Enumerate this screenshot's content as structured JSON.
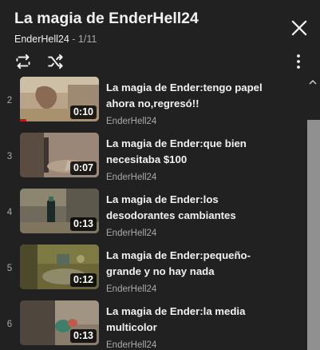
{
  "header": {
    "title": "La magia de EnderHell24",
    "channel": "EnderHell24",
    "separator": " - ",
    "position": "1/11"
  },
  "controls": {
    "loop_icon": "loop-icon",
    "shuffle_icon": "shuffle-icon",
    "more_icon": "more-vert-icon",
    "close_icon": "close-icon"
  },
  "colors": {
    "background": "#212121",
    "text": "#f1f1f1",
    "secondary_text": "#aaaaaa",
    "progress_red": "#ff0000",
    "scrollbar": "#909090"
  },
  "videos": [
    {
      "index": "2",
      "title_line1": "La magia de Ender:tengo papel",
      "title_line2": "ahora no,regresó!!",
      "channel": "EnderHell24",
      "duration": "0:10",
      "watched_fraction": 0.08
    },
    {
      "index": "3",
      "title_line1": "La magia de Ender:que bien",
      "title_line2": "necesitaba $100",
      "channel": "EnderHell24",
      "duration": "0:07"
    },
    {
      "index": "4",
      "title_line1": "La magia de Ender:los",
      "title_line2": "desodorantes cambiantes",
      "channel": "EnderHell24",
      "duration": "0:13"
    },
    {
      "index": "5",
      "title_line1": "La magia de Ender:pequeño-",
      "title_line2": "grande y no hay nada",
      "channel": "EnderHell24",
      "duration": "0:12"
    },
    {
      "index": "6",
      "title_line1": "La magia de Ender:la media",
      "title_line2": "multicolor",
      "channel": "EnderHell24",
      "duration": "0:13"
    }
  ]
}
